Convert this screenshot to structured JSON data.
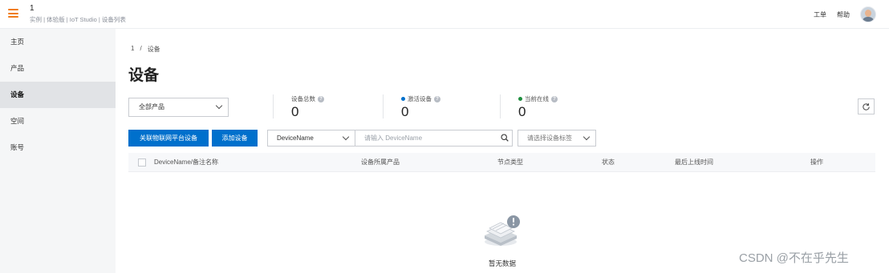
{
  "header": {
    "app_title": "1",
    "subtitle": "实例 | 体验版 | IoT Studio | 设备列表",
    "links": {
      "ticket": "工单",
      "help": "帮助"
    }
  },
  "sidebar": {
    "items": [
      {
        "label": "主页"
      },
      {
        "label": "产品"
      },
      {
        "label": "设备",
        "active": true
      },
      {
        "label": "空间"
      },
      {
        "label": "账号"
      }
    ]
  },
  "main": {
    "breadcrumb": {
      "root": "1",
      "separator": "/",
      "current": "设备"
    },
    "page_title": "设备",
    "product_filter": {
      "selected": "全部产品"
    },
    "stats": {
      "total": {
        "label": "设备总数",
        "value": "0"
      },
      "activated": {
        "label": "激活设备",
        "value": "0",
        "color": "#0070cc"
      },
      "online": {
        "label": "当前在线",
        "value": "0",
        "color": "#1e8e3e"
      }
    },
    "toolbar": {
      "associate_button": "关联物联网平台设备",
      "add_button": "添加设备",
      "field_select": "DeviceName",
      "search_placeholder": "请输入 DeviceName",
      "tag_select_placeholder": "请选择设备标签"
    },
    "table": {
      "columns": [
        "DeviceName/备注名称",
        "设备所属产品",
        "节点类型",
        "状态",
        "最后上线时间",
        "操作"
      ]
    },
    "empty_state": {
      "text": "暂无数据"
    }
  },
  "watermark": "CSDN @不在乎先生",
  "colors": {
    "accent": "#0070cc",
    "menu_icon": "#f07c1a",
    "online": "#1e8e3e"
  }
}
